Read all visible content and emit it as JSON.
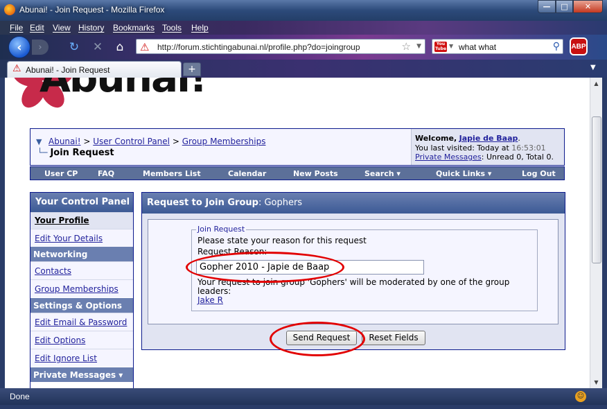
{
  "window": {
    "title": "Abunai! - Join Request - Mozilla Firefox"
  },
  "menu": [
    "File",
    "Edit",
    "View",
    "History",
    "Bookmarks",
    "Tools",
    "Help"
  ],
  "address": {
    "url": "http://forum.stichtingabunai.nl/profile.php?do=joingroup"
  },
  "search": {
    "value": "what what",
    "engine_icon": "youtube-icon"
  },
  "tab": {
    "label": "Abunai! - Join Request"
  },
  "logo": {
    "text": "Abunai!"
  },
  "breadcrumb": {
    "items": [
      "Abunai!",
      "User Control Panel",
      "Group Memberships"
    ],
    "separator": ">",
    "current": "Join Request"
  },
  "welcome": {
    "label": "Welcome,",
    "user": "Japie de Baap",
    "last_visited_label": "You last visited: Today at",
    "last_visited_time": "16:53:01",
    "pm_link": "Private Messages",
    "pm_info": ": Unread 0, Total 0."
  },
  "navstrip": [
    "User CP",
    "FAQ",
    "Members List",
    "Calendar",
    "New Posts",
    "Search ▾",
    "Quick Links ▾",
    "Log Out"
  ],
  "ucp": {
    "title": "Your Control Panel",
    "profile_link": "Your Profile",
    "edit_details": "Edit Your Details",
    "networking": "Networking",
    "contacts": "Contacts",
    "group_memberships": "Group Memberships",
    "settings": "Settings & Options",
    "edit_email": "Edit Email & Password",
    "edit_options": "Edit Options",
    "edit_ignore": "Edit Ignore List",
    "private_messages": "Private Messages ▾"
  },
  "panel": {
    "title_bold": "Request to Join Group",
    "title_group": ": Gophers",
    "legend": "Join Request",
    "instruction": "Please state your reason for this request",
    "reason_label": "Request Reason:",
    "reason_value": "Gopher 2010 - Japie de Baap",
    "moderation_line1": "Your request to join group 'Gophers' will be moderated by one of the group",
    "moderation_line2": "leaders:",
    "leader": "Jake R"
  },
  "buttons": {
    "send": "Send Request",
    "reset": "Reset Fields"
  },
  "status": {
    "text": "Done"
  },
  "colors": {
    "highlight": "#e20000",
    "link": "#22229c",
    "header": "#3c5a95"
  }
}
